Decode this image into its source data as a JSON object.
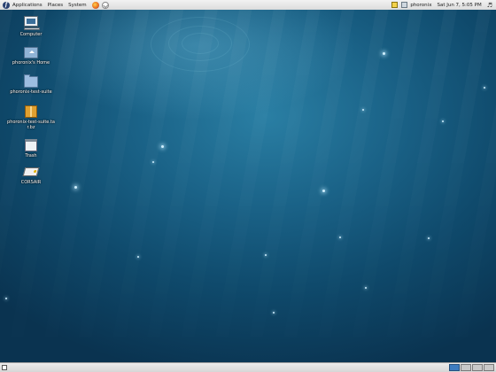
{
  "top_panel": {
    "menus": [
      "Applications",
      "Places",
      "System"
    ],
    "username": "phoronix",
    "datetime": "Sat Jun  7,  5:05 PM"
  },
  "desktop_icons": [
    {
      "label": "Computer",
      "icon": "computer-icon"
    },
    {
      "label": "phoronix's Home",
      "icon": "home-folder-icon"
    },
    {
      "label": "phoronix-test-suite",
      "icon": "folder-icon"
    },
    {
      "label": "phoronix-test-suite.tar.bz",
      "icon": "package-icon"
    },
    {
      "label": "Trash",
      "icon": "trash-icon"
    },
    {
      "label": "CORSAIR",
      "icon": "drive-icon"
    }
  ],
  "bottom_panel": {
    "workspaces": 4,
    "active_workspace": 1
  },
  "colors": {
    "desktop_base": "#0d3c5a",
    "panel": "#e4e4e4",
    "active_workspace": "#3d7cc0"
  }
}
